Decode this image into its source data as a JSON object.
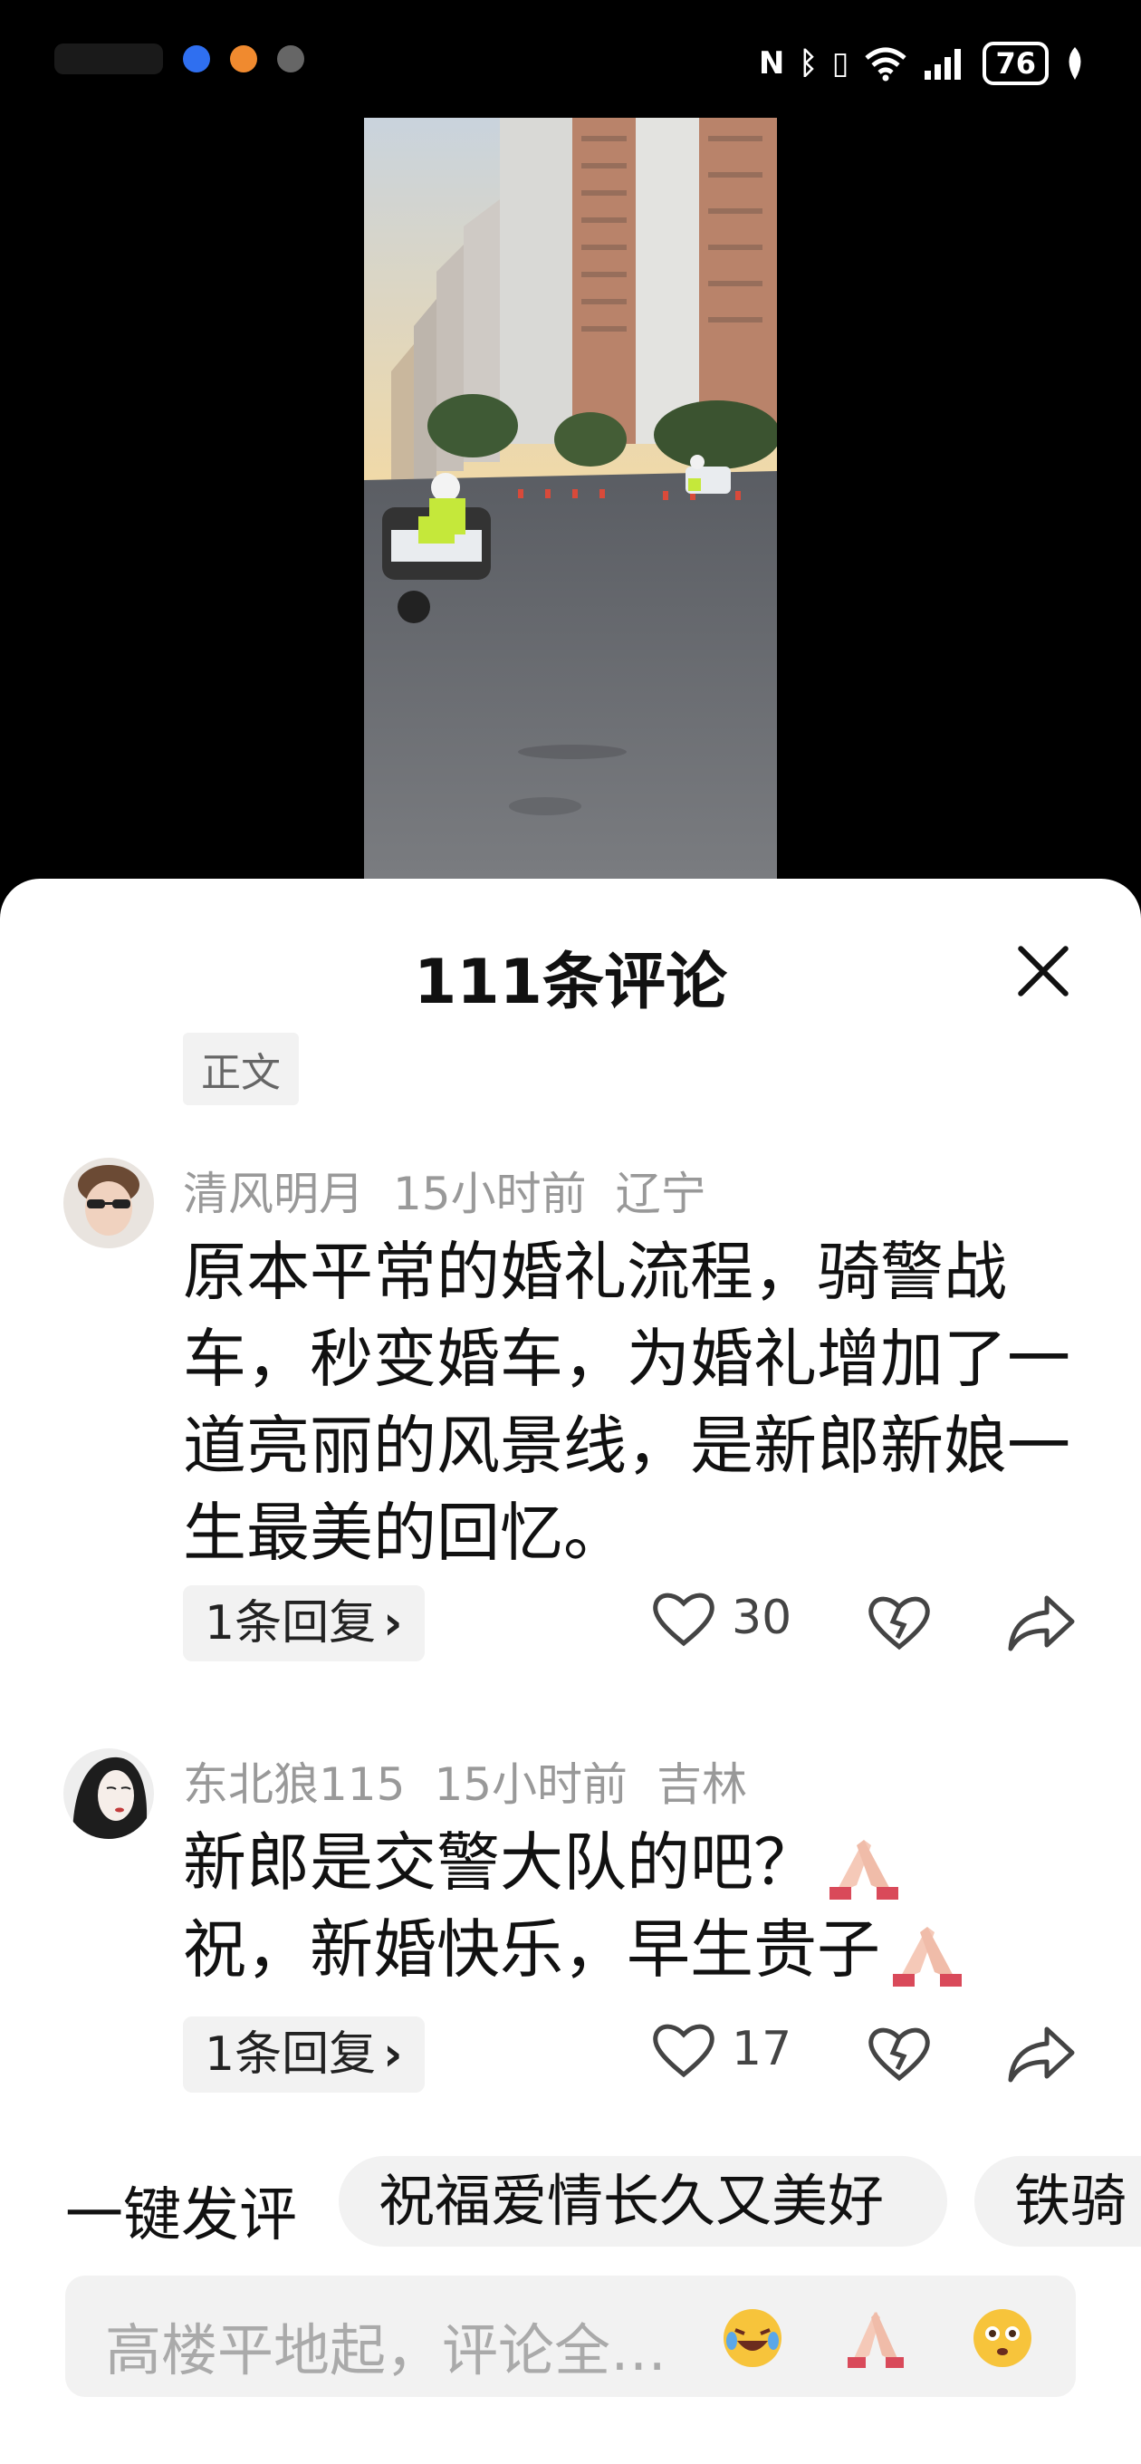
{
  "status_bar": {
    "battery": "76",
    "icons": [
      "nfc-icon",
      "bluetooth-icon",
      "vibrate-icon",
      "wifi-icon",
      "signal-icon",
      "battery-icon",
      "leaf-icon"
    ]
  },
  "sheet": {
    "title": "111条评论",
    "tag": "正文"
  },
  "comments": [
    {
      "user": "清风明月",
      "time": "15小时前",
      "location": "辽宁",
      "text": "原本平常的婚礼流程，骑警战车，秒变婚车，为婚礼增加了一道亮丽的风景线，是新郎新娘一生最美的回忆。",
      "replies": "1条回复",
      "likes": "30"
    },
    {
      "user": "东北狼115",
      "time": "15小时前",
      "location": "吉林",
      "text_line1": "新郎是交警大队的吧？",
      "text_line2": "祝，新婚快乐，早生贵子",
      "replies": "1条回复",
      "likes": "17"
    }
  ],
  "quick_reply": {
    "label": "一键发评",
    "chips": [
      "祝福爱情长久又美好",
      "铁骑"
    ]
  },
  "input": {
    "placeholder": "高楼平地起，评论全…"
  },
  "colors": {
    "sheet_bg": "#ffffff",
    "chip_bg": "#f2f2f2",
    "meta_text": "#999999"
  }
}
